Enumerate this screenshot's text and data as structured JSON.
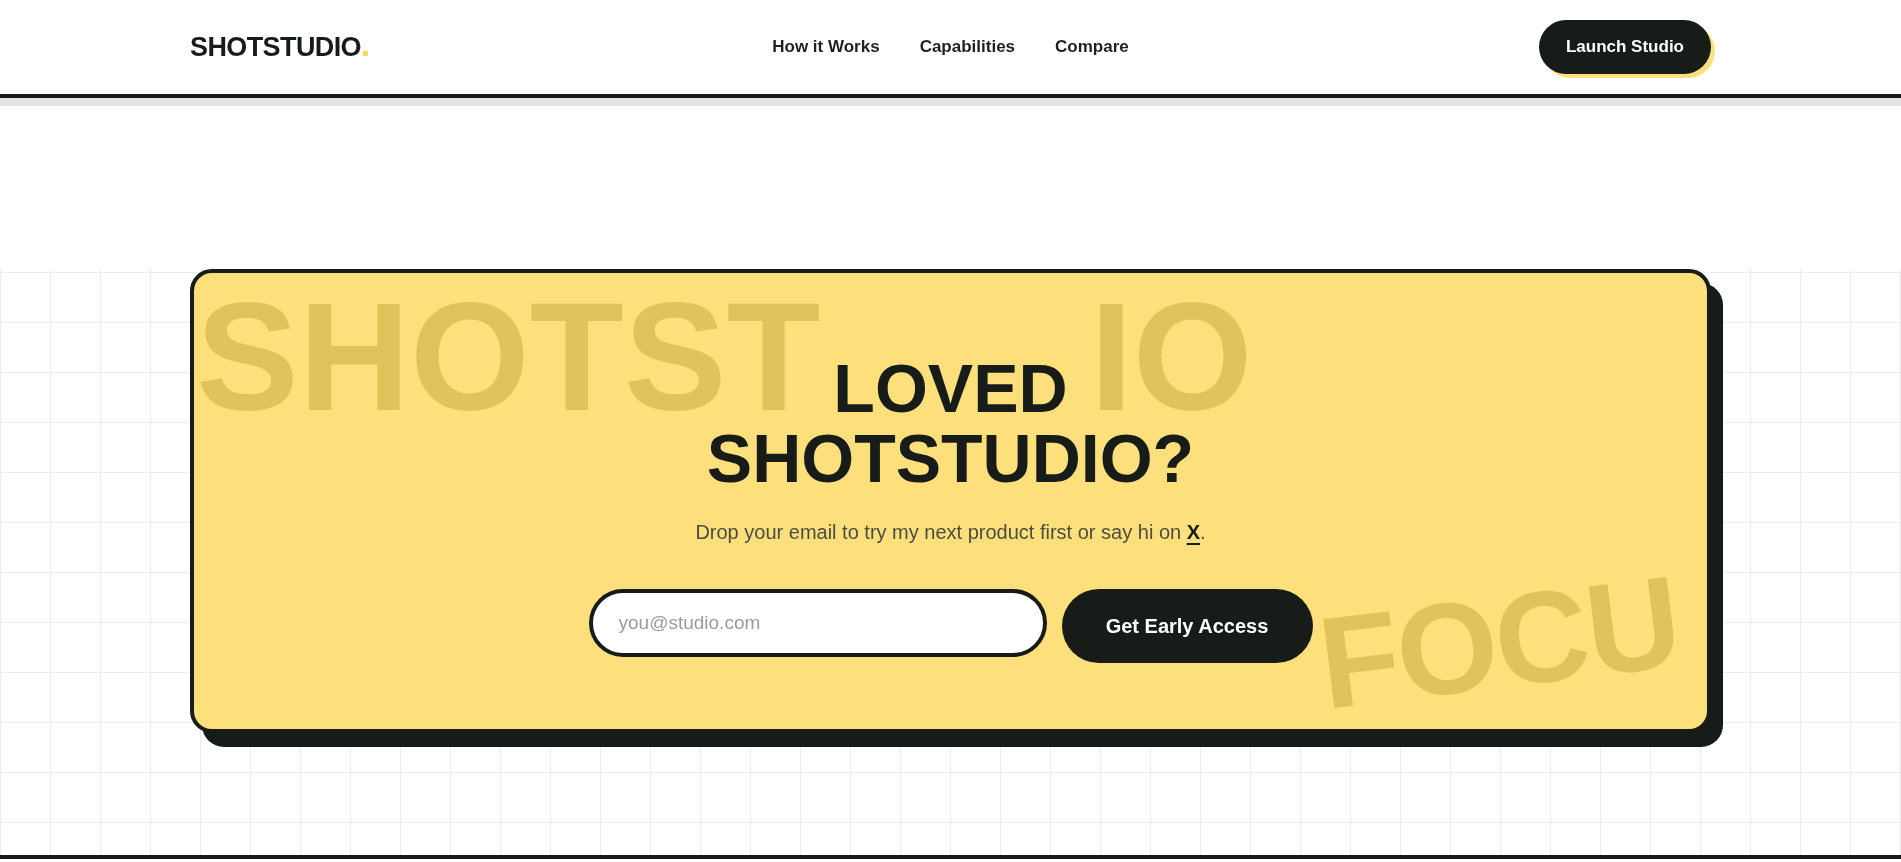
{
  "header": {
    "logo": "SHOTSTUDIO",
    "nav": [
      {
        "label": "How it Works"
      },
      {
        "label": "Capabilities"
      },
      {
        "label": "Compare"
      }
    ],
    "cta": "Launch Studio"
  },
  "cta_card": {
    "background_texts": [
      {
        "kind": "left",
        "text": "SHOTST"
      },
      {
        "kind": "right",
        "text": "IO"
      },
      {
        "kind": "tilted",
        "text": "FOCU"
      }
    ],
    "heading_lines": [
      "LOVED",
      "SHOTSTUDIO?"
    ],
    "subtitle": {
      "text": "Drop your email to try my next product first or say hi on ",
      "link": "X",
      "after": "."
    },
    "email_field": {
      "placeholder": "you@studio.com"
    },
    "button": "Get Early Access"
  }
}
